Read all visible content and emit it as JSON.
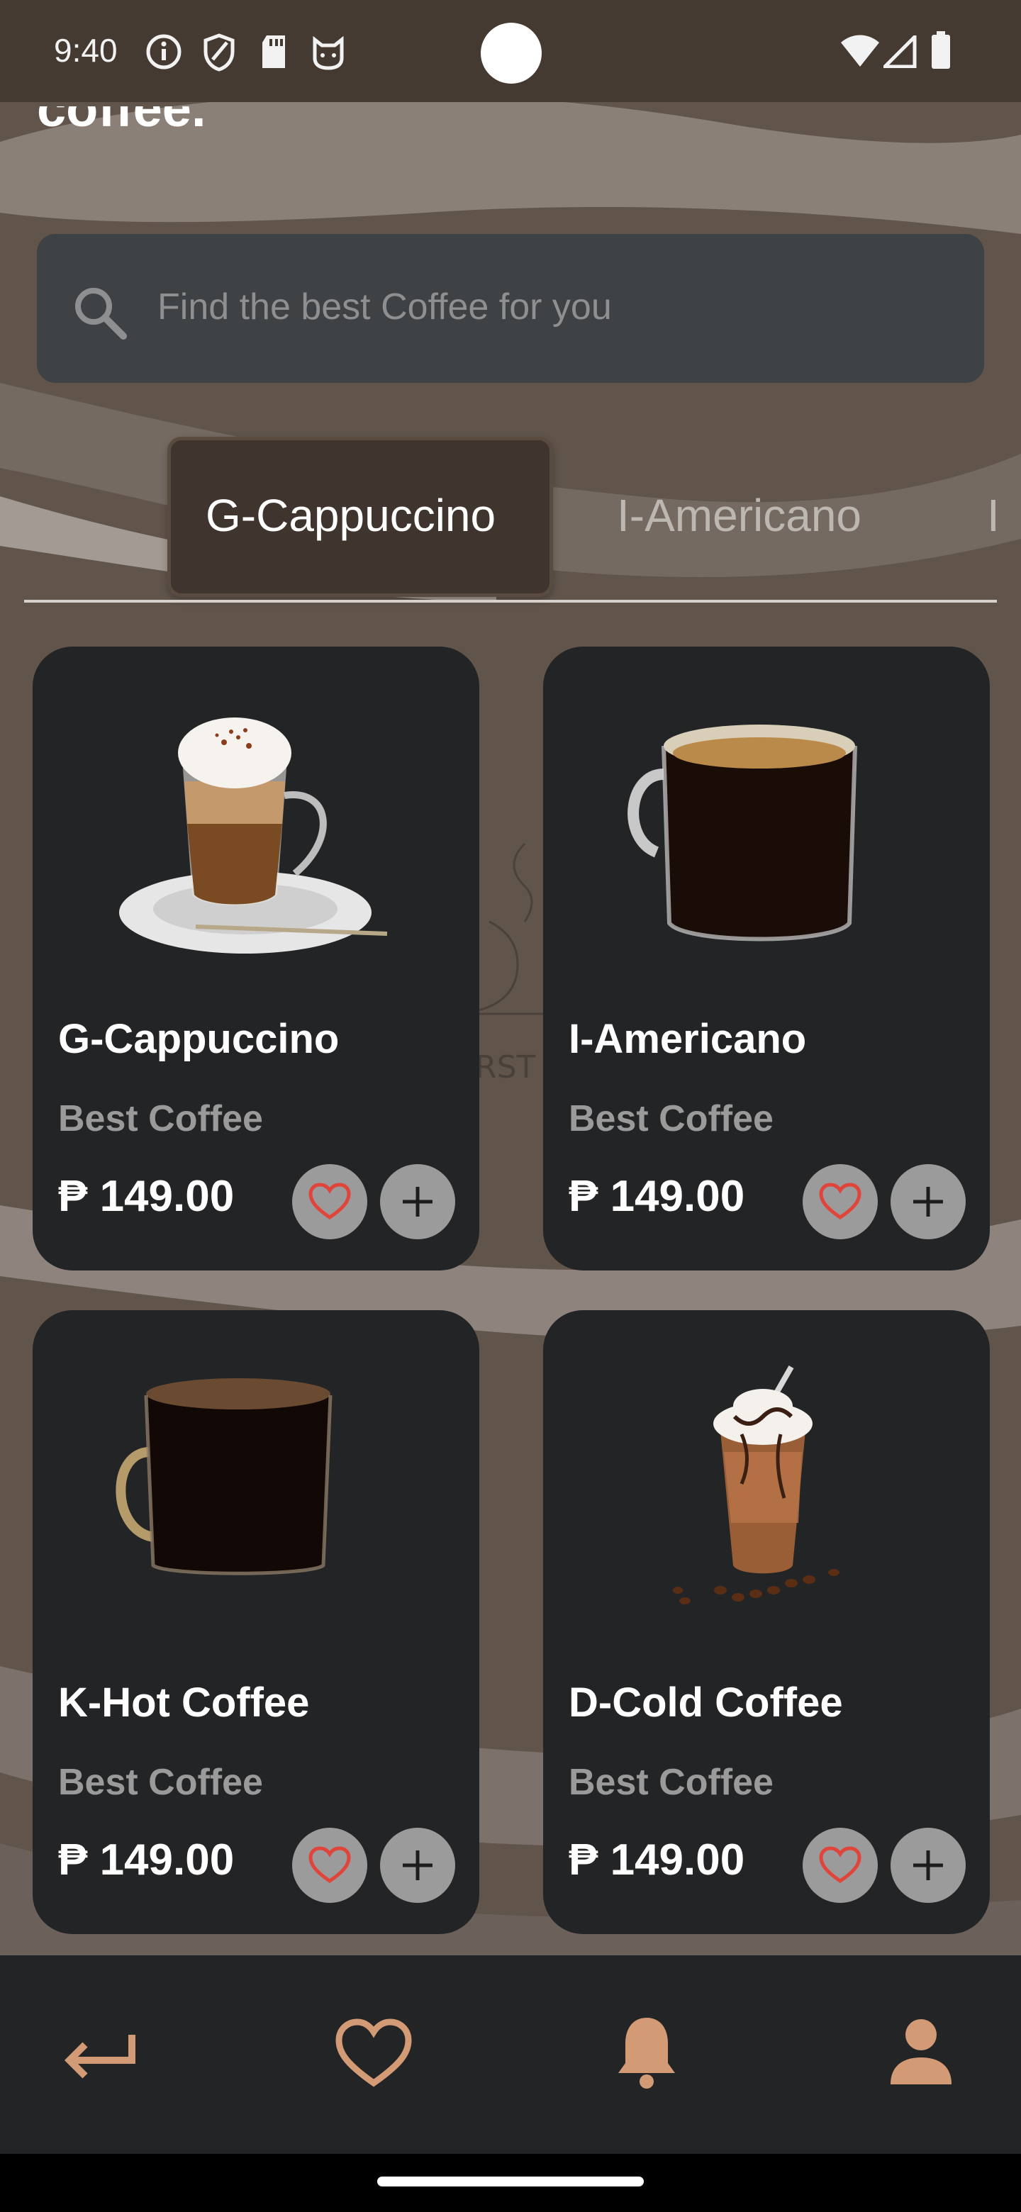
{
  "status_bar": {
    "time": "9:40"
  },
  "header": {
    "title": "coffee."
  },
  "search": {
    "placeholder": "Find the best Coffee for you"
  },
  "tabs": [
    {
      "label": "G-Cappuccino",
      "active": true
    },
    {
      "label": "I-Americano",
      "active": false
    },
    {
      "label": "I",
      "active": false
    }
  ],
  "products": [
    {
      "name": "G-Cappuccino",
      "subtitle": "Best Coffee",
      "price": "₱ 149.00",
      "image": "cappuccino-glass"
    },
    {
      "name": "I-Americano",
      "subtitle": "Best Coffee",
      "price": "₱ 149.00",
      "image": "americano-mug"
    },
    {
      "name": "K-Hot Coffee",
      "subtitle": "Best Coffee",
      "price": "₱ 149.00",
      "image": "hot-coffee-mug"
    },
    {
      "name": "D-Cold Coffee",
      "subtitle": "Best Coffee",
      "price": "₱ 149.00",
      "image": "iced-coffee-cup"
    }
  ],
  "bottom_nav": [
    {
      "icon": "back-arrow-icon"
    },
    {
      "icon": "heart-icon"
    },
    {
      "icon": "bell-icon"
    },
    {
      "icon": "profile-icon"
    }
  ],
  "colors": {
    "accent": "#d39a76",
    "card": "#222426",
    "heart": "#e0443a",
    "status_bar": "#453a32",
    "background": "#5f534b"
  }
}
